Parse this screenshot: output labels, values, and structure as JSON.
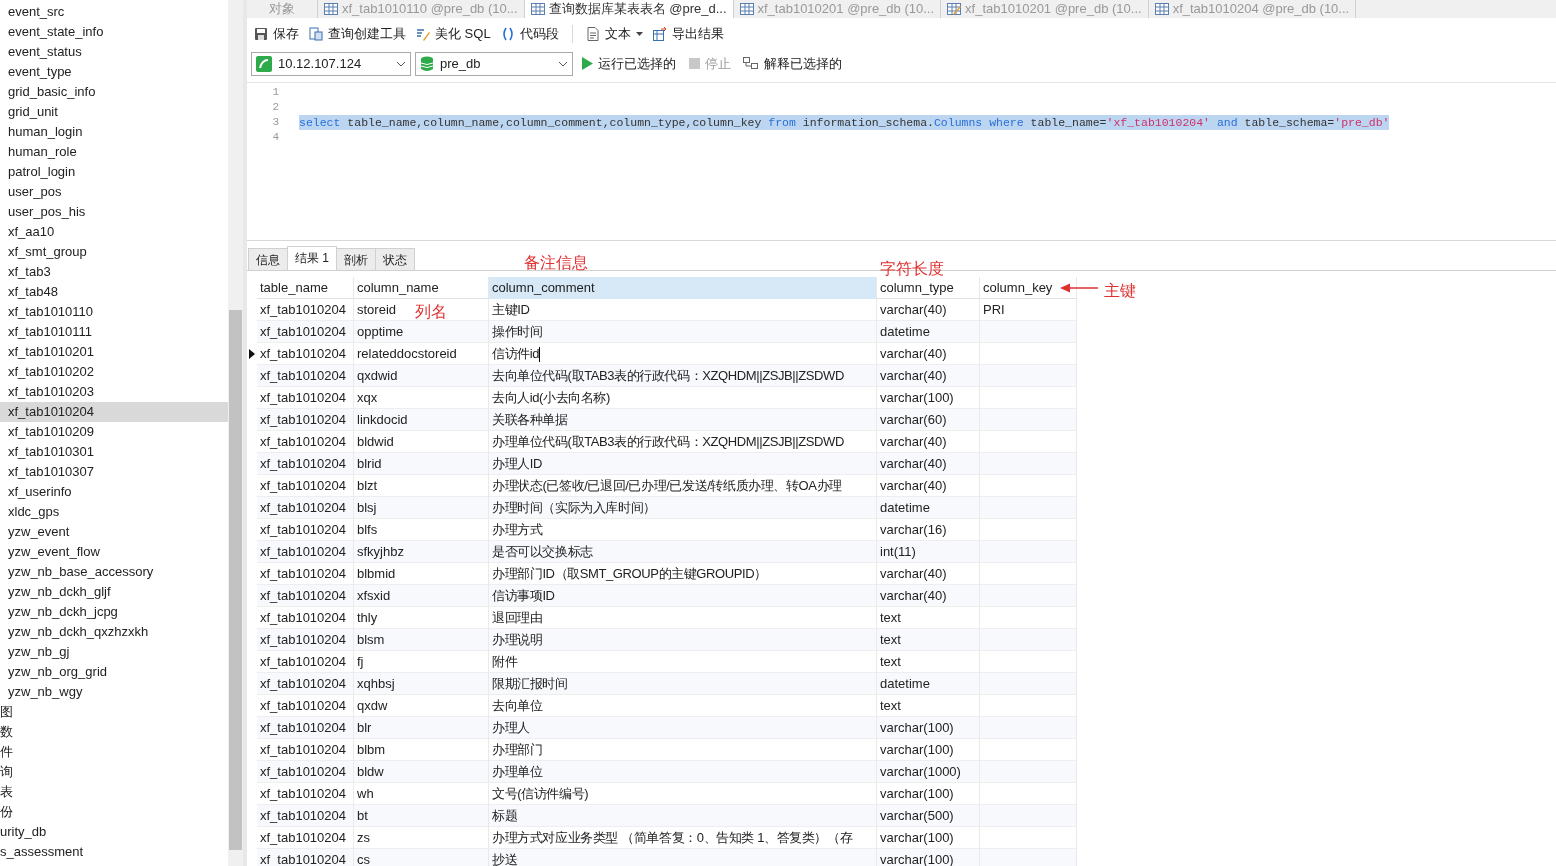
{
  "sidebar": {
    "items": [
      {
        "label": "event_src",
        "kind": "table",
        "selected": false
      },
      {
        "label": "event_state_info",
        "kind": "table",
        "selected": false
      },
      {
        "label": "event_status",
        "kind": "table",
        "selected": false
      },
      {
        "label": "event_type",
        "kind": "table",
        "selected": false
      },
      {
        "label": "grid_basic_info",
        "kind": "table",
        "selected": false
      },
      {
        "label": "grid_unit",
        "kind": "table",
        "selected": false
      },
      {
        "label": "human_login",
        "kind": "table",
        "selected": false
      },
      {
        "label": "human_role",
        "kind": "table",
        "selected": false
      },
      {
        "label": "patrol_login",
        "kind": "table",
        "selected": false
      },
      {
        "label": "user_pos",
        "kind": "table",
        "selected": false
      },
      {
        "label": "user_pos_his",
        "kind": "table",
        "selected": false
      },
      {
        "label": "xf_aa10",
        "kind": "table",
        "selected": false
      },
      {
        "label": "xf_smt_group",
        "kind": "table",
        "selected": false
      },
      {
        "label": "xf_tab3",
        "kind": "table",
        "selected": false
      },
      {
        "label": "xf_tab48",
        "kind": "table",
        "selected": false
      },
      {
        "label": "xf_tab1010110",
        "kind": "table",
        "selected": false
      },
      {
        "label": "xf_tab1010111",
        "kind": "table",
        "selected": false
      },
      {
        "label": "xf_tab1010201",
        "kind": "table",
        "selected": false
      },
      {
        "label": "xf_tab1010202",
        "kind": "table",
        "selected": false
      },
      {
        "label": "xf_tab1010203",
        "kind": "table",
        "selected": false
      },
      {
        "label": "xf_tab1010204",
        "kind": "table",
        "selected": true
      },
      {
        "label": "xf_tab1010209",
        "kind": "table",
        "selected": false
      },
      {
        "label": "xf_tab1010301",
        "kind": "table",
        "selected": false
      },
      {
        "label": "xf_tab1010307",
        "kind": "table",
        "selected": false
      },
      {
        "label": "xf_userinfo",
        "kind": "table",
        "selected": false
      },
      {
        "label": "xldc_gps",
        "kind": "table",
        "selected": false
      },
      {
        "label": "yzw_event",
        "kind": "table",
        "selected": false
      },
      {
        "label": "yzw_event_flow",
        "kind": "table",
        "selected": false
      },
      {
        "label": "yzw_nb_base_accessory",
        "kind": "table",
        "selected": false
      },
      {
        "label": "yzw_nb_dckh_gljf",
        "kind": "table",
        "selected": false
      },
      {
        "label": "yzw_nb_dckh_jcpg",
        "kind": "table",
        "selected": false
      },
      {
        "label": "yzw_nb_dckh_qxzhzxkh",
        "kind": "table",
        "selected": false
      },
      {
        "label": "yzw_nb_gj",
        "kind": "table",
        "selected": false
      },
      {
        "label": "yzw_nb_org_grid",
        "kind": "table",
        "selected": false
      },
      {
        "label": "yzw_nb_wgy",
        "kind": "table",
        "selected": false
      },
      {
        "label": "图",
        "kind": "folder",
        "selected": false
      },
      {
        "label": "数",
        "kind": "folder",
        "selected": false
      },
      {
        "label": "件",
        "kind": "folder",
        "selected": false
      },
      {
        "label": "询",
        "kind": "folder",
        "selected": false
      },
      {
        "label": "表",
        "kind": "folder",
        "selected": false
      },
      {
        "label": "份",
        "kind": "folder",
        "selected": false
      },
      {
        "label": "urity_db",
        "kind": "folder",
        "selected": false
      },
      {
        "label": "s_assessment",
        "kind": "folder",
        "selected": false
      }
    ]
  },
  "doc_tabs": [
    {
      "label": "对象",
      "kind": "object",
      "selected": false
    },
    {
      "label": "xf_tab1010110 @pre_db (10...",
      "kind": "table",
      "selected": false
    },
    {
      "label": "查询数据库某表表名 @pre_d...",
      "kind": "query",
      "selected": true
    },
    {
      "label": "xf_tab1010201 @pre_db (10...",
      "kind": "table",
      "selected": false
    },
    {
      "label": "xf_tab1010201 @pre_db (10...",
      "kind": "design",
      "selected": false
    },
    {
      "label": "xf_tab1010204 @pre_db (10...",
      "kind": "table",
      "selected": false
    }
  ],
  "toolbar": [
    {
      "label": "保存",
      "kind": "save"
    },
    {
      "label": "查询创建工具",
      "kind": "builder"
    },
    {
      "label": "美化 SQL",
      "kind": "beautify"
    },
    {
      "label": "代码段",
      "kind": "snippet"
    },
    {
      "label": "文本",
      "kind": "text"
    },
    {
      "label": "导出结果",
      "kind": "export"
    }
  ],
  "connection": {
    "value": "10.12.107.124"
  },
  "database": {
    "value": "pre_db"
  },
  "run_bar": [
    {
      "label": "运行已选择的",
      "kind": "run",
      "disabled": false
    },
    {
      "label": "停止",
      "kind": "stop",
      "disabled": true
    },
    {
      "label": "解释已选择的",
      "kind": "explain",
      "disabled": false
    }
  ],
  "editor": {
    "lines": [
      {
        "number": "1",
        "selected": false
      },
      {
        "number": "2",
        "selected": false
      },
      {
        "number": "3",
        "selected": true,
        "tokens": [
          {
            "text": "select",
            "kind": "keyword"
          },
          {
            "text": " table_name,column_name,column_comment,column_type,column_key ",
            "kind": "plain"
          },
          {
            "text": "from",
            "kind": "keyword"
          },
          {
            "text": " information_schema.",
            "kind": "plain"
          },
          {
            "text": "Columns",
            "kind": "keyword"
          },
          {
            "text": " where",
            "kind": "keyword"
          },
          {
            "text": " table_name=",
            "kind": "plain"
          },
          {
            "text": "'xf_tab1010204'",
            "kind": "string"
          },
          {
            "text": " and",
            "kind": "keyword"
          },
          {
            "text": " table_schema=",
            "kind": "plain"
          },
          {
            "text": "'pre_db'",
            "kind": "string"
          }
        ]
      },
      {
        "number": "4",
        "selected": false
      }
    ]
  },
  "result_tabs": [
    {
      "label": "信息",
      "selected": false
    },
    {
      "label": "结果 1",
      "selected": true
    },
    {
      "label": "剖析",
      "selected": false
    },
    {
      "label": "状态",
      "selected": false
    }
  ],
  "table": {
    "columns": [
      {
        "label": "table_name",
        "selected": false
      },
      {
        "label": "column_name",
        "selected": false
      },
      {
        "label": "column_comment",
        "selected": true
      },
      {
        "label": "column_type",
        "selected": false
      },
      {
        "label": "column_key",
        "selected": false
      }
    ],
    "rows": [
      {
        "current": false,
        "cells": [
          "xf_tab1010204",
          "storeid",
          "主键ID",
          "varchar(40)",
          "PRI"
        ]
      },
      {
        "current": false,
        "cells": [
          "xf_tab1010204",
          "opptime",
          "操作时间",
          "datetime",
          ""
        ]
      },
      {
        "current": true,
        "cells": [
          "xf_tab1010204",
          "relateddocstoreid",
          "信访件id",
          "varchar(40)",
          ""
        ]
      },
      {
        "current": false,
        "cells": [
          "xf_tab1010204",
          "qxdwid",
          "去向单位代码(取TAB3表的行政代码：XZQHDM||ZSJB||ZSDWD",
          "varchar(40)",
          ""
        ]
      },
      {
        "current": false,
        "cells": [
          "xf_tab1010204",
          "xqx",
          "去向人id(小去向名称)",
          "varchar(100)",
          ""
        ]
      },
      {
        "current": false,
        "cells": [
          "xf_tab1010204",
          "linkdocid",
          "关联各种单据",
          "varchar(60)",
          ""
        ]
      },
      {
        "current": false,
        "cells": [
          "xf_tab1010204",
          "bldwid",
          "办理单位代码(取TAB3表的行政代码：XZQHDM||ZSJB||ZSDWD",
          "varchar(40)",
          ""
        ]
      },
      {
        "current": false,
        "cells": [
          "xf_tab1010204",
          "blrid",
          "办理人ID",
          "varchar(40)",
          ""
        ]
      },
      {
        "current": false,
        "cells": [
          "xf_tab1010204",
          "blzt",
          "办理状态(已签收/已退回/已办理/已发送/转纸质办理、转OA办理",
          "varchar(40)",
          ""
        ]
      },
      {
        "current": false,
        "cells": [
          "xf_tab1010204",
          "blsj",
          "办理时间（实际为入库时间）",
          "datetime",
          ""
        ]
      },
      {
        "current": false,
        "cells": [
          "xf_tab1010204",
          "blfs",
          "办理方式",
          "varchar(16)",
          ""
        ]
      },
      {
        "current": false,
        "cells": [
          "xf_tab1010204",
          "sfkyjhbz",
          "是否可以交换标志",
          "int(11)",
          ""
        ]
      },
      {
        "current": false,
        "cells": [
          "xf_tab1010204",
          "blbmid",
          "办理部门ID（取SMT_GROUP的主键GROUPID）",
          "varchar(40)",
          ""
        ]
      },
      {
        "current": false,
        "cells": [
          "xf_tab1010204",
          "xfsxid",
          "信访事项ID",
          "varchar(40)",
          ""
        ]
      },
      {
        "current": false,
        "cells": [
          "xf_tab1010204",
          "thly",
          "退回理由",
          "text",
          ""
        ]
      },
      {
        "current": false,
        "cells": [
          "xf_tab1010204",
          "blsm",
          "办理说明",
          "text",
          ""
        ]
      },
      {
        "current": false,
        "cells": [
          "xf_tab1010204",
          "fj",
          "附件",
          "text",
          ""
        ]
      },
      {
        "current": false,
        "cells": [
          "xf_tab1010204",
          "xqhbsj",
          "限期汇报时间",
          "datetime",
          ""
        ]
      },
      {
        "current": false,
        "cells": [
          "xf_tab1010204",
          "qxdw",
          "去向单位",
          "text",
          ""
        ]
      },
      {
        "current": false,
        "cells": [
          "xf_tab1010204",
          "blr",
          "办理人",
          "varchar(100)",
          ""
        ]
      },
      {
        "current": false,
        "cells": [
          "xf_tab1010204",
          "blbm",
          "办理部门",
          "varchar(100)",
          ""
        ]
      },
      {
        "current": false,
        "cells": [
          "xf_tab1010204",
          "bldw",
          "办理单位",
          "varchar(1000)",
          ""
        ]
      },
      {
        "current": false,
        "cells": [
          "xf_tab1010204",
          "wh",
          "文号(信访件编号)",
          "varchar(100)",
          ""
        ]
      },
      {
        "current": false,
        "cells": [
          "xf_tab1010204",
          "bt",
          "标题",
          "varchar(500)",
          ""
        ]
      },
      {
        "current": false,
        "cells": [
          "xf_tab1010204",
          "zs",
          "办理方式对应业务类型 （简单答复：0、告知类 1、答复类）（存",
          "varchar(100)",
          ""
        ]
      },
      {
        "current": false,
        "cells": [
          "xf_tab1010204",
          "cs",
          "抄送",
          "varchar(100)",
          ""
        ]
      }
    ]
  },
  "annotations": [
    {
      "text": "备注信息",
      "kind": "label"
    },
    {
      "text": "字符长度",
      "kind": "label"
    },
    {
      "text": "列名",
      "kind": "label"
    },
    {
      "text": "主键",
      "kind": "arrow_label"
    }
  ]
}
